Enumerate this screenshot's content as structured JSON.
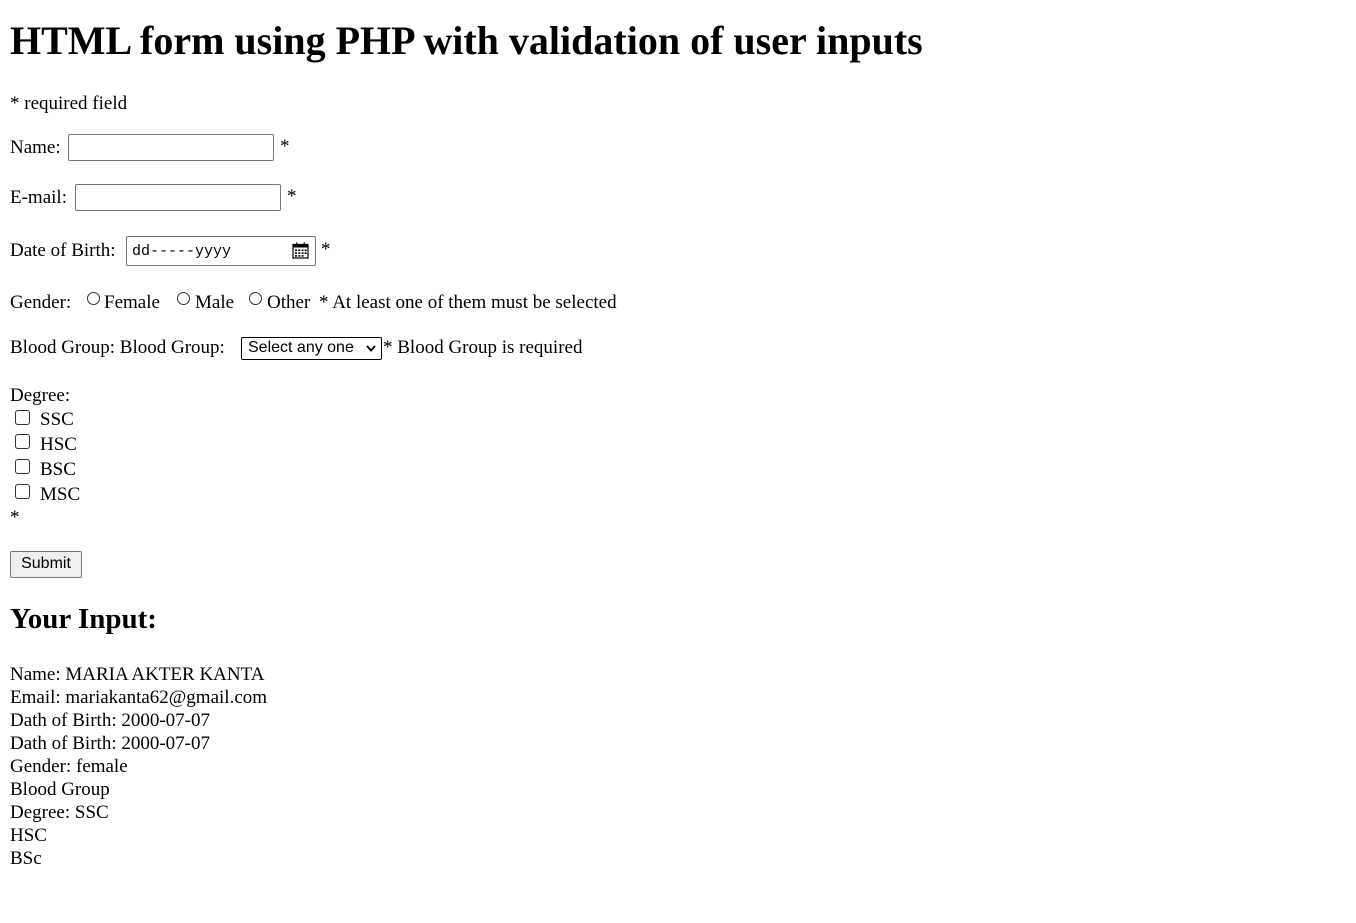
{
  "page": {
    "title": "HTML form using PHP with validation of user inputs",
    "required_note": "* required field"
  },
  "form": {
    "name": {
      "label": "Name:",
      "value": "",
      "required_mark": "*"
    },
    "email": {
      "label": "E-mail:",
      "value": "",
      "required_mark": "*"
    },
    "dob": {
      "label": "Date of Birth:",
      "placeholder": "dd-----yyyy",
      "required_mark": "*"
    },
    "gender": {
      "label": "Gender:",
      "options": [
        "Female",
        "Male",
        "Other"
      ],
      "selected": null,
      "error": "* At least one of them must be selected"
    },
    "blood_group": {
      "label": "Blood Group: Blood Group:",
      "selected_option": "Select any one",
      "error": "* Blood Group is required"
    },
    "degree": {
      "label": "Degree:",
      "options": [
        "SSC",
        "HSC",
        "BSC",
        "MSC"
      ],
      "checked": [],
      "required_mark": "*"
    },
    "submit_label": "Submit"
  },
  "output": {
    "heading": "Your Input:",
    "lines": [
      "Name: MARIA AKTER KANTA",
      "Email: mariakanta62@gmail.com",
      "Dath of Birth: 2000-07-07",
      "Dath of Birth: 2000-07-07",
      "Gender: female",
      "Blood Group",
      "Degree: SSC",
      "HSC",
      "BSc"
    ]
  },
  "icons": {
    "date_picker": "calendar-icon",
    "select_arrow": "chevron-down-icon"
  }
}
